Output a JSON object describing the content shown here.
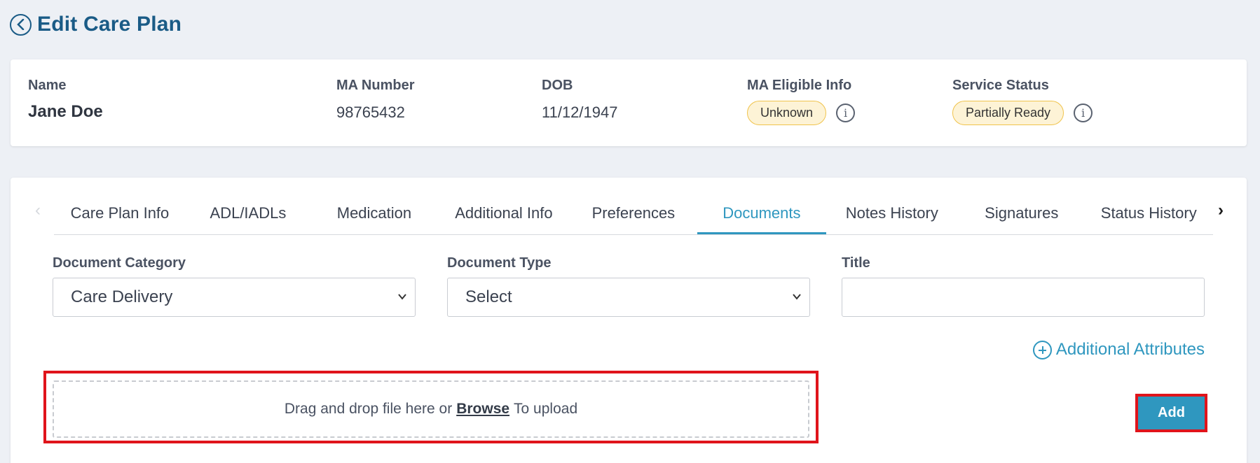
{
  "header": {
    "title": "Edit Care Plan"
  },
  "patient": {
    "name_label": "Name",
    "name": "Jane Doe",
    "ma_number_label": "MA Number",
    "ma_number": "98765432",
    "dob_label": "DOB",
    "dob": "11/12/1947",
    "ma_eligible_label": "MA Eligible Info",
    "ma_eligible_status": "Unknown",
    "service_status_label": "Service Status",
    "service_status": "Partially Ready"
  },
  "tabs": {
    "items": [
      "Care Plan Info",
      "ADL/IADLs",
      "Medication",
      "Additional Info",
      "Preferences",
      "Documents",
      "Notes History",
      "Signatures",
      "Status History"
    ],
    "active": "Documents"
  },
  "form": {
    "category_label": "Document Category",
    "category_value": "Care Delivery",
    "type_label": "Document Type",
    "type_value": "Select",
    "title_label": "Title",
    "title_value": "",
    "additional_attributes": "Additional Attributes",
    "dropzone_text_before": "Drag and drop file here or",
    "dropzone_browse": "Browse",
    "dropzone_text_after": "To upload",
    "add_label": "Add"
  },
  "colors": {
    "title_blue": "#1a5b86",
    "accent": "#2f97bf",
    "badge_bg": "#fdf3d6",
    "badge_border": "#f0c34c",
    "highlight_red": "#e0141b",
    "page_bg": "#edf0f5"
  }
}
